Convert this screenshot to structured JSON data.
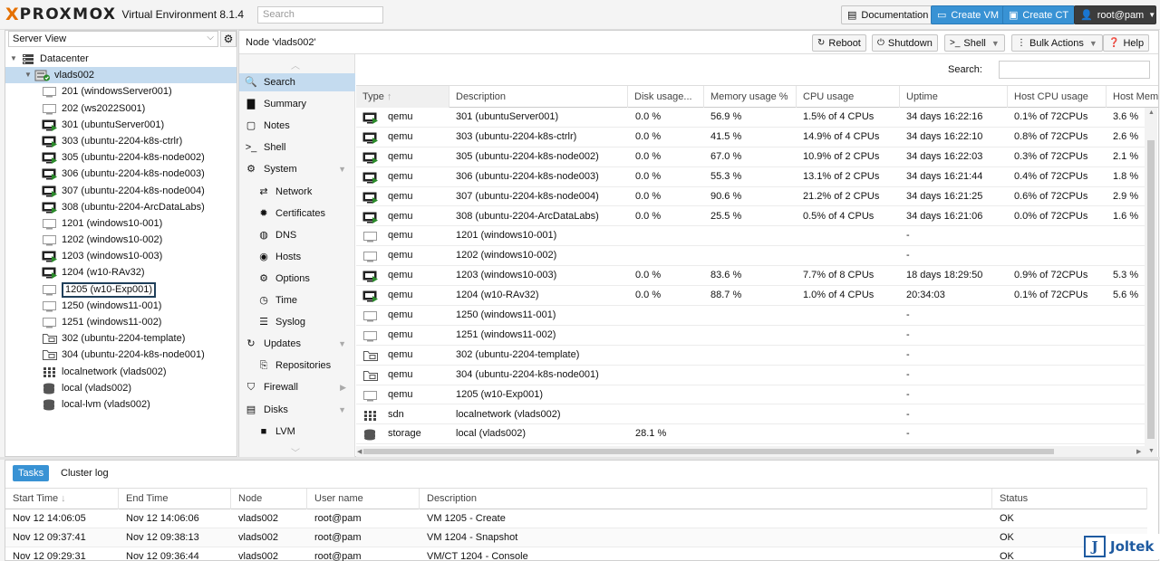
{
  "topbar": {
    "brand_x": "X",
    "brand": "PROXMOX",
    "version": "Virtual Environment 8.1.4",
    "search_placeholder": "Search",
    "documentation": "Documentation",
    "create_vm": "Create VM",
    "create_ct": "Create CT",
    "user": "root@pam"
  },
  "sidebar": {
    "view": "Server View",
    "tree": [
      {
        "label": "Datacenter",
        "icon": "datacenter-icon",
        "level": 0
      },
      {
        "label": "vlads002",
        "icon": "node-icon",
        "level": 1
      },
      {
        "label": "201 (windowsServer001)",
        "icon": "vm-stopped-icon",
        "level": 2
      },
      {
        "label": "202 (ws2022S001)",
        "icon": "vm-stopped-icon",
        "level": 2
      },
      {
        "label": "301 (ubuntuServer001)",
        "icon": "vm-running-icon",
        "level": 2
      },
      {
        "label": "303 (ubuntu-2204-k8s-ctrlr)",
        "icon": "vm-running-icon",
        "level": 2
      },
      {
        "label": "305 (ubuntu-2204-k8s-node002)",
        "icon": "vm-running-icon",
        "level": 2
      },
      {
        "label": "306 (ubuntu-2204-k8s-node003)",
        "icon": "vm-running-icon",
        "level": 2
      },
      {
        "label": "307 (ubuntu-2204-k8s-node004)",
        "icon": "vm-running-icon",
        "level": 2
      },
      {
        "label": "308 (ubuntu-2204-ArcDataLabs)",
        "icon": "vm-running-icon",
        "level": 2
      },
      {
        "label": "1201 (windows10-001)",
        "icon": "vm-stopped-icon",
        "level": 2
      },
      {
        "label": "1202 (windows10-002)",
        "icon": "vm-stopped-icon",
        "level": 2
      },
      {
        "label": "1203 (windows10-003)",
        "icon": "vm-running-icon",
        "level": 2
      },
      {
        "label": "1204 (w10-RAv32)",
        "icon": "vm-running-icon",
        "level": 2
      },
      {
        "label": "1205 (w10-Exp001)",
        "icon": "vm-stopped-icon",
        "level": 2
      },
      {
        "label": "1250 (windows11-001)",
        "icon": "vm-stopped-icon",
        "level": 2
      },
      {
        "label": "1251 (windows11-002)",
        "icon": "vm-stopped-icon",
        "level": 2
      },
      {
        "label": "302 (ubuntu-2204-template)",
        "icon": "template-icon",
        "level": 2
      },
      {
        "label": "304 (ubuntu-2204-k8s-node001)",
        "icon": "template-icon",
        "level": 2
      },
      {
        "label": "localnetwork (vlads002)",
        "icon": "sdn-icon",
        "level": 2
      },
      {
        "label": "local (vlads002)",
        "icon": "storage-icon",
        "level": 2
      },
      {
        "label": "local-lvm (vlads002)",
        "icon": "storage-icon",
        "level": 2
      }
    ]
  },
  "content": {
    "title": "Node 'vlads002'",
    "reboot": "Reboot",
    "shutdown": "Shutdown",
    "shell": "Shell",
    "bulk_actions": "Bulk Actions",
    "help": "Help"
  },
  "nav": [
    {
      "label": "Search",
      "icon": "search-icon",
      "glyph": "🔍"
    },
    {
      "label": "Summary",
      "icon": "book-icon",
      "glyph": "▇"
    },
    {
      "label": "Notes",
      "icon": "notes-icon",
      "glyph": "▢"
    },
    {
      "label": "Shell",
      "icon": "terminal-icon",
      "glyph": ">_"
    },
    {
      "label": "System",
      "icon": "cogs-icon",
      "glyph": "⚙"
    },
    {
      "label": "Network",
      "icon": "network-icon",
      "glyph": "⇄"
    },
    {
      "label": "Certificates",
      "icon": "certificate-icon",
      "glyph": "✹"
    },
    {
      "label": "DNS",
      "icon": "globe-icon",
      "glyph": "◍"
    },
    {
      "label": "Hosts",
      "icon": "hosts-icon",
      "glyph": "◉"
    },
    {
      "label": "Options",
      "icon": "gear-icon",
      "glyph": "⚙"
    },
    {
      "label": "Time",
      "icon": "clock-icon",
      "glyph": "◷"
    },
    {
      "label": "Syslog",
      "icon": "list-icon",
      "glyph": "☰"
    },
    {
      "label": "Updates",
      "icon": "refresh-icon",
      "glyph": "↻"
    },
    {
      "label": "Repositories",
      "icon": "repository-icon",
      "glyph": "⎘"
    },
    {
      "label": "Firewall",
      "icon": "shield-icon",
      "glyph": "⛉"
    },
    {
      "label": "Disks",
      "icon": "disk-icon",
      "glyph": "▤"
    },
    {
      "label": "LVM",
      "icon": "square-icon",
      "glyph": "■"
    }
  ],
  "grid": {
    "search_label": "Search:",
    "columns": [
      "Type",
      "Description",
      "Disk usage...",
      "Memory usage %",
      "CPU usage",
      "Uptime",
      "Host CPU usage",
      "Host Mem"
    ],
    "rows": [
      {
        "icon": "vm-running-icon",
        "type": "qemu",
        "desc": "301 (ubuntuServer001)",
        "disk": "0.0 %",
        "mem": "56.9 %",
        "cpu": "1.5% of 4 CPUs",
        "uptime": "34 days 16:22:16",
        "hcpu": "0.1% of 72CPUs",
        "hmem": "3.6 %"
      },
      {
        "icon": "vm-running-icon",
        "type": "qemu",
        "desc": "303 (ubuntu-2204-k8s-ctrlr)",
        "disk": "0.0 %",
        "mem": "41.5 %",
        "cpu": "14.9% of 4 CPUs",
        "uptime": "34 days 16:22:10",
        "hcpu": "0.8% of 72CPUs",
        "hmem": "2.6 %"
      },
      {
        "icon": "vm-running-icon",
        "type": "qemu",
        "desc": "305 (ubuntu-2204-k8s-node002)",
        "disk": "0.0 %",
        "mem": "67.0 %",
        "cpu": "10.9% of 2 CPUs",
        "uptime": "34 days 16:22:03",
        "hcpu": "0.3% of 72CPUs",
        "hmem": "2.1 %"
      },
      {
        "icon": "vm-running-icon",
        "type": "qemu",
        "desc": "306 (ubuntu-2204-k8s-node003)",
        "disk": "0.0 %",
        "mem": "55.3 %",
        "cpu": "13.1% of 2 CPUs",
        "uptime": "34 days 16:21:44",
        "hcpu": "0.4% of 72CPUs",
        "hmem": "1.8 %"
      },
      {
        "icon": "vm-running-icon",
        "type": "qemu",
        "desc": "307 (ubuntu-2204-k8s-node004)",
        "disk": "0.0 %",
        "mem": "90.6 %",
        "cpu": "21.2% of 2 CPUs",
        "uptime": "34 days 16:21:25",
        "hcpu": "0.6% of 72CPUs",
        "hmem": "2.9 %"
      },
      {
        "icon": "vm-running-icon",
        "type": "qemu",
        "desc": "308 (ubuntu-2204-ArcDataLabs)",
        "disk": "0.0 %",
        "mem": "25.5 %",
        "cpu": "0.5% of 4 CPUs",
        "uptime": "34 days 16:21:06",
        "hcpu": "0.0% of 72CPUs",
        "hmem": "1.6 %"
      },
      {
        "icon": "vm-stopped-icon",
        "type": "qemu",
        "desc": "1201 (windows10-001)",
        "disk": "",
        "mem": "",
        "cpu": "",
        "uptime": "-",
        "hcpu": "",
        "hmem": ""
      },
      {
        "icon": "vm-stopped-icon",
        "type": "qemu",
        "desc": "1202 (windows10-002)",
        "disk": "",
        "mem": "",
        "cpu": "",
        "uptime": "-",
        "hcpu": "",
        "hmem": ""
      },
      {
        "icon": "vm-running-icon",
        "type": "qemu",
        "desc": "1203 (windows10-003)",
        "disk": "0.0 %",
        "mem": "83.6 %",
        "cpu": "7.7% of 8 CPUs",
        "uptime": "18 days 18:29:50",
        "hcpu": "0.9% of 72CPUs",
        "hmem": "5.3 %"
      },
      {
        "icon": "vm-running-icon",
        "type": "qemu",
        "desc": "1204 (w10-RAv32)",
        "disk": "0.0 %",
        "mem": "88.7 %",
        "cpu": "1.0% of 4 CPUs",
        "uptime": "20:34:03",
        "hcpu": "0.1% of 72CPUs",
        "hmem": "5.6 %"
      },
      {
        "icon": "vm-stopped-icon",
        "type": "qemu",
        "desc": "1250 (windows11-001)",
        "disk": "",
        "mem": "",
        "cpu": "",
        "uptime": "-",
        "hcpu": "",
        "hmem": ""
      },
      {
        "icon": "vm-stopped-icon",
        "type": "qemu",
        "desc": "1251 (windows11-002)",
        "disk": "",
        "mem": "",
        "cpu": "",
        "uptime": "-",
        "hcpu": "",
        "hmem": ""
      },
      {
        "icon": "template-icon",
        "type": "qemu",
        "desc": "302 (ubuntu-2204-template)",
        "disk": "",
        "mem": "",
        "cpu": "",
        "uptime": "-",
        "hcpu": "",
        "hmem": ""
      },
      {
        "icon": "template-icon",
        "type": "qemu",
        "desc": "304 (ubuntu-2204-k8s-node001)",
        "disk": "",
        "mem": "",
        "cpu": "",
        "uptime": "-",
        "hcpu": "",
        "hmem": ""
      },
      {
        "icon": "vm-stopped-icon",
        "type": "qemu",
        "desc": "1205 (w10-Exp001)",
        "disk": "",
        "mem": "",
        "cpu": "",
        "uptime": "-",
        "hcpu": "",
        "hmem": ""
      },
      {
        "icon": "sdn-icon",
        "type": "sdn",
        "desc": "localnetwork (vlads002)",
        "disk": "",
        "mem": "",
        "cpu": "",
        "uptime": "-",
        "hcpu": "",
        "hmem": ""
      },
      {
        "icon": "storage-icon",
        "type": "storage",
        "desc": "local (vlads002)",
        "disk": "28.1 %",
        "mem": "",
        "cpu": "",
        "uptime": "-",
        "hcpu": "",
        "hmem": ""
      }
    ]
  },
  "log": {
    "tabs": [
      "Tasks",
      "Cluster log"
    ],
    "columns": [
      "Start Time",
      "End Time",
      "Node",
      "User name",
      "Description",
      "Status"
    ],
    "rows": [
      {
        "start": "Nov 12 14:06:05",
        "end": "Nov 12 14:06:06",
        "node": "vlads002",
        "user": "root@pam",
        "desc": "VM 1205 - Create",
        "status": "OK"
      },
      {
        "start": "Nov 12 09:37:41",
        "end": "Nov 12 09:38:13",
        "node": "vlads002",
        "user": "root@pam",
        "desc": "VM 1204 - Snapshot",
        "status": "OK"
      },
      {
        "start": "Nov 12 09:29:31",
        "end": "Nov 12 09:36:44",
        "node": "vlads002",
        "user": "root@pam",
        "desc": "VM/CT 1204 - Console",
        "status": "OK"
      }
    ]
  },
  "watermark": {
    "glyph": "J",
    "text": "Joltek"
  },
  "colors": {
    "accent": "#3892d4",
    "selection": "#c4dbef",
    "brand_orange": "#e57000",
    "running_green": "#2a8a2a"
  }
}
